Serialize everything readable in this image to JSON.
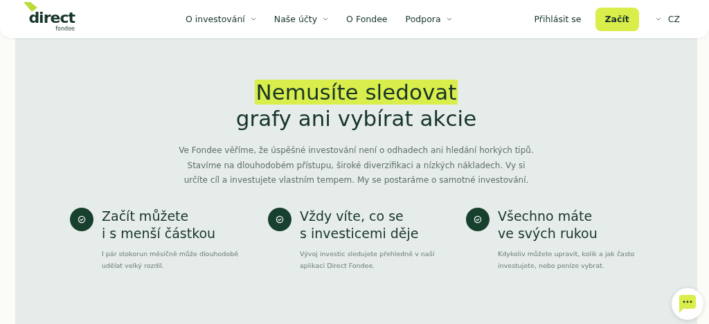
{
  "header": {
    "logo": {
      "name": "direct",
      "sub": "fondee"
    },
    "nav": [
      {
        "label": "O investování",
        "dropdown": true
      },
      {
        "label": "Naše účty",
        "dropdown": true
      },
      {
        "label": "O Fondee",
        "dropdown": false
      },
      {
        "label": "Podpora",
        "dropdown": true
      }
    ],
    "login": "Přihlásit se",
    "cta": "Začít",
    "language": "CZ"
  },
  "hero": {
    "title_highlight": "Nemusíte sledovat",
    "title_rest": "grafy ani vybírat akcie",
    "text": "Ve Fondee věříme, že úspěšné investování není o odhadech ani hledání horkých tipů. Stavíme na dlouhodobém přístupu, široké diverzifikaci a nízkých nákladech. Vy si určíte cíl a investujete vlastním tempem. My se postaráme o samotné investování."
  },
  "features": [
    {
      "title": [
        "Začít můžete",
        "i s menší částkou"
      ],
      "text": "I pár stokorun měsíčně může dlouhodobě udělat velký rozdíl."
    },
    {
      "title": [
        "Vždy víte, co se",
        "s investicemi děje"
      ],
      "text": "Vývoj investic sledujete přehledně v naší aplikaci Direct Fondee."
    },
    {
      "title": [
        "Všechno máte",
        "ve svých rukou"
      ],
      "text": "Kdykoliv můžete upravit, kolik a jak často investujete, nebo peníze vybrat."
    }
  ]
}
